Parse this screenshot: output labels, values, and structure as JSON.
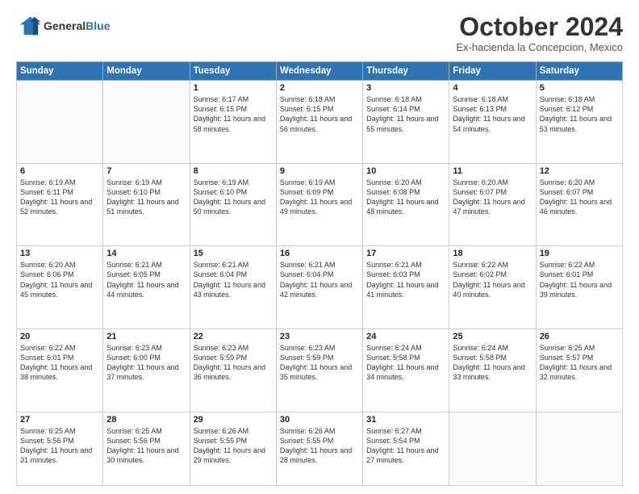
{
  "header": {
    "logo_line1": "General",
    "logo_line2": "Blue",
    "month": "October 2024",
    "location": "Ex-hacienda la Concepcion, Mexico"
  },
  "weekdays": [
    "Sunday",
    "Monday",
    "Tuesday",
    "Wednesday",
    "Thursday",
    "Friday",
    "Saturday"
  ],
  "weeks": [
    [
      {
        "day": "",
        "sunrise": "",
        "sunset": "",
        "daylight": ""
      },
      {
        "day": "",
        "sunrise": "",
        "sunset": "",
        "daylight": ""
      },
      {
        "day": "1",
        "sunrise": "Sunrise: 6:17 AM",
        "sunset": "Sunset: 6:15 PM",
        "daylight": "Daylight: 11 hours and 58 minutes."
      },
      {
        "day": "2",
        "sunrise": "Sunrise: 6:18 AM",
        "sunset": "Sunset: 6:15 PM",
        "daylight": "Daylight: 11 hours and 56 minutes."
      },
      {
        "day": "3",
        "sunrise": "Sunrise: 6:18 AM",
        "sunset": "Sunset: 6:14 PM",
        "daylight": "Daylight: 11 hours and 55 minutes."
      },
      {
        "day": "4",
        "sunrise": "Sunrise: 6:18 AM",
        "sunset": "Sunset: 6:13 PM",
        "daylight": "Daylight: 11 hours and 54 minutes."
      },
      {
        "day": "5",
        "sunrise": "Sunrise: 6:18 AM",
        "sunset": "Sunset: 6:12 PM",
        "daylight": "Daylight: 11 hours and 53 minutes."
      }
    ],
    [
      {
        "day": "6",
        "sunrise": "Sunrise: 6:19 AM",
        "sunset": "Sunset: 6:11 PM",
        "daylight": "Daylight: 11 hours and 52 minutes."
      },
      {
        "day": "7",
        "sunrise": "Sunrise: 6:19 AM",
        "sunset": "Sunset: 6:10 PM",
        "daylight": "Daylight: 11 hours and 51 minutes."
      },
      {
        "day": "8",
        "sunrise": "Sunrise: 6:19 AM",
        "sunset": "Sunset: 6:10 PM",
        "daylight": "Daylight: 11 hours and 50 minutes."
      },
      {
        "day": "9",
        "sunrise": "Sunrise: 6:19 AM",
        "sunset": "Sunset: 6:09 PM",
        "daylight": "Daylight: 11 hours and 49 minutes."
      },
      {
        "day": "10",
        "sunrise": "Sunrise: 6:20 AM",
        "sunset": "Sunset: 6:08 PM",
        "daylight": "Daylight: 11 hours and 48 minutes."
      },
      {
        "day": "11",
        "sunrise": "Sunrise: 6:20 AM",
        "sunset": "Sunset: 6:07 PM",
        "daylight": "Daylight: 11 hours and 47 minutes."
      },
      {
        "day": "12",
        "sunrise": "Sunrise: 6:20 AM",
        "sunset": "Sunset: 6:07 PM",
        "daylight": "Daylight: 11 hours and 46 minutes."
      }
    ],
    [
      {
        "day": "13",
        "sunrise": "Sunrise: 6:20 AM",
        "sunset": "Sunset: 6:06 PM",
        "daylight": "Daylight: 11 hours and 45 minutes."
      },
      {
        "day": "14",
        "sunrise": "Sunrise: 6:21 AM",
        "sunset": "Sunset: 6:05 PM",
        "daylight": "Daylight: 11 hours and 44 minutes."
      },
      {
        "day": "15",
        "sunrise": "Sunrise: 6:21 AM",
        "sunset": "Sunset: 6:04 PM",
        "daylight": "Daylight: 11 hours and 43 minutes."
      },
      {
        "day": "16",
        "sunrise": "Sunrise: 6:21 AM",
        "sunset": "Sunset: 6:04 PM",
        "daylight": "Daylight: 11 hours and 42 minutes."
      },
      {
        "day": "17",
        "sunrise": "Sunrise: 6:21 AM",
        "sunset": "Sunset: 6:03 PM",
        "daylight": "Daylight: 11 hours and 41 minutes."
      },
      {
        "day": "18",
        "sunrise": "Sunrise: 6:22 AM",
        "sunset": "Sunset: 6:02 PM",
        "daylight": "Daylight: 11 hours and 40 minutes."
      },
      {
        "day": "19",
        "sunrise": "Sunrise: 6:22 AM",
        "sunset": "Sunset: 6:01 PM",
        "daylight": "Daylight: 11 hours and 39 minutes."
      }
    ],
    [
      {
        "day": "20",
        "sunrise": "Sunrise: 6:22 AM",
        "sunset": "Sunset: 6:01 PM",
        "daylight": "Daylight: 11 hours and 38 minutes."
      },
      {
        "day": "21",
        "sunrise": "Sunrise: 6:23 AM",
        "sunset": "Sunset: 6:00 PM",
        "daylight": "Daylight: 11 hours and 37 minutes."
      },
      {
        "day": "22",
        "sunrise": "Sunrise: 6:23 AM",
        "sunset": "Sunset: 5:59 PM",
        "daylight": "Daylight: 11 hours and 36 minutes."
      },
      {
        "day": "23",
        "sunrise": "Sunrise: 6:23 AM",
        "sunset": "Sunset: 5:59 PM",
        "daylight": "Daylight: 11 hours and 35 minutes."
      },
      {
        "day": "24",
        "sunrise": "Sunrise: 6:24 AM",
        "sunset": "Sunset: 5:58 PM",
        "daylight": "Daylight: 11 hours and 34 minutes."
      },
      {
        "day": "25",
        "sunrise": "Sunrise: 6:24 AM",
        "sunset": "Sunset: 5:58 PM",
        "daylight": "Daylight: 11 hours and 33 minutes."
      },
      {
        "day": "26",
        "sunrise": "Sunrise: 6:25 AM",
        "sunset": "Sunset: 5:57 PM",
        "daylight": "Daylight: 11 hours and 32 minutes."
      }
    ],
    [
      {
        "day": "27",
        "sunrise": "Sunrise: 6:25 AM",
        "sunset": "Sunset: 5:56 PM",
        "daylight": "Daylight: 11 hours and 31 minutes."
      },
      {
        "day": "28",
        "sunrise": "Sunrise: 6:25 AM",
        "sunset": "Sunset: 5:56 PM",
        "daylight": "Daylight: 11 hours and 30 minutes."
      },
      {
        "day": "29",
        "sunrise": "Sunrise: 6:26 AM",
        "sunset": "Sunset: 5:55 PM",
        "daylight": "Daylight: 11 hours and 29 minutes."
      },
      {
        "day": "30",
        "sunrise": "Sunrise: 6:26 AM",
        "sunset": "Sunset: 5:55 PM",
        "daylight": "Daylight: 11 hours and 28 minutes."
      },
      {
        "day": "31",
        "sunrise": "Sunrise: 6:27 AM",
        "sunset": "Sunset: 5:54 PM",
        "daylight": "Daylight: 11 hours and 27 minutes."
      },
      {
        "day": "",
        "sunrise": "",
        "sunset": "",
        "daylight": ""
      },
      {
        "day": "",
        "sunrise": "",
        "sunset": "",
        "daylight": ""
      }
    ]
  ]
}
